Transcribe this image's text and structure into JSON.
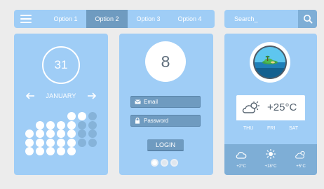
{
  "nav": {
    "menu_icon": "hamburger-icon",
    "options": [
      "Option 1",
      "Option 2",
      "Option 3",
      "Option 4"
    ],
    "active_index": 1
  },
  "search": {
    "placeholder": "Search_",
    "icon": "search-icon"
  },
  "calendar": {
    "day": "31",
    "month": "JANUARY",
    "prev_icon": "arrow-left-icon",
    "next_icon": "arrow-right-icon"
  },
  "login": {
    "avatar_text": "8",
    "email_label": "Email",
    "password_label": "Password",
    "login_label": "LOGIN",
    "pager_count": 3
  },
  "weather": {
    "temperature": "+25°C",
    "days": [
      "THU",
      "FRI",
      "SAT"
    ],
    "forecast": [
      {
        "icon": "cloud-icon",
        "temp": "+2°C"
      },
      {
        "icon": "sun-icon",
        "temp": "+18°C"
      },
      {
        "icon": "partly-cloudy-icon",
        "temp": "+5°C"
      }
    ]
  },
  "colors": {
    "card": "#9fcdf6",
    "active_tab": "#6f9bc0",
    "dark_panel": "#7eaed6",
    "background": "#ececec"
  }
}
